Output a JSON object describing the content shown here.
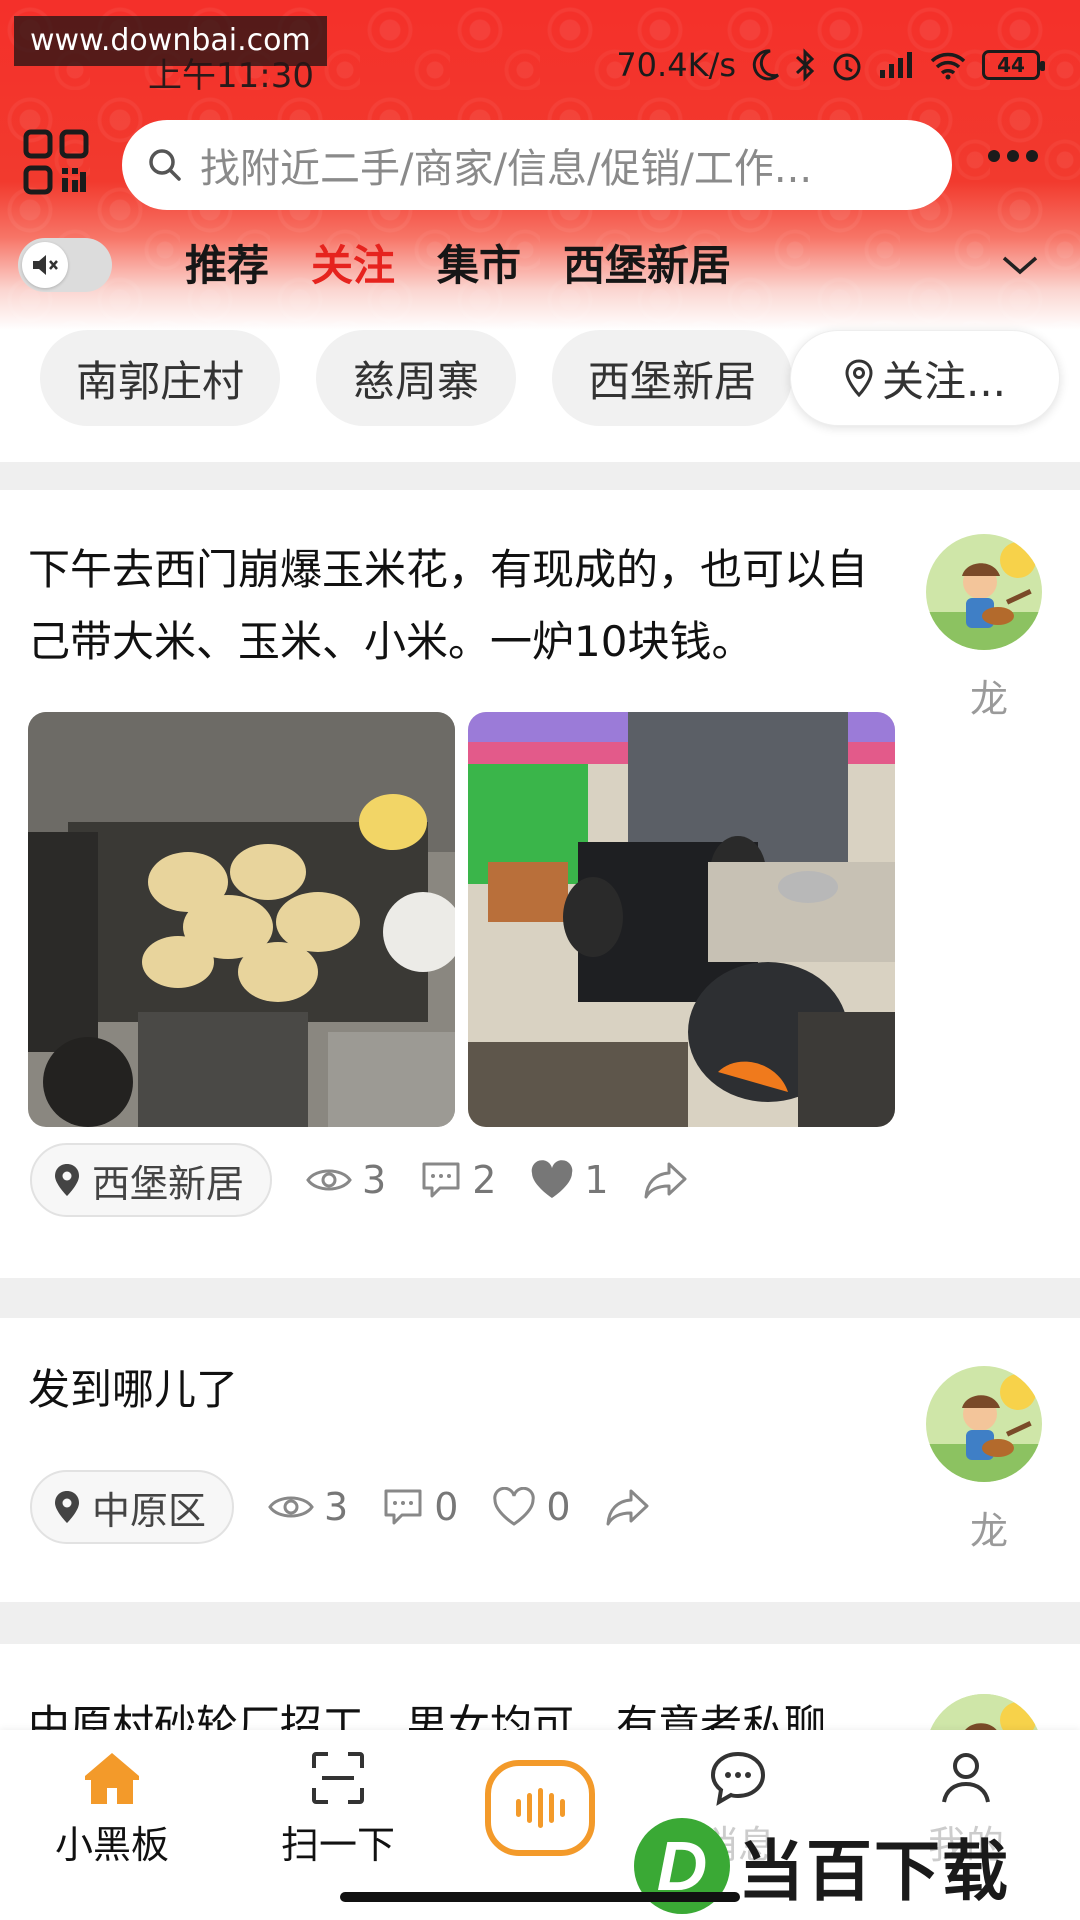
{
  "watermark_top": "www.downbai.com",
  "status": {
    "time": "上午11:30",
    "speed": "70.4K/s",
    "battery": "44"
  },
  "search": {
    "placeholder": "找附近二手/商家/信息/促销/工作..."
  },
  "tabs": [
    {
      "label": "推荐",
      "active": false
    },
    {
      "label": "关注",
      "active": true
    },
    {
      "label": "集市",
      "active": false
    },
    {
      "label": "西堡新居",
      "active": false
    }
  ],
  "location_chips": [
    "南郭庄村",
    "慈周寨",
    "西堡新居",
    "关注..."
  ],
  "posts": [
    {
      "text": "下午去西门崩爆玉米花，有现成的，也可以自己带大米、玉米、小米。一炉10块钱。",
      "author": "龙",
      "location": "西堡新居",
      "views": "3",
      "comments": "2",
      "likes": "1"
    },
    {
      "text": "发到哪儿了",
      "author": "龙",
      "location": "中原区",
      "views": "3",
      "comments": "0",
      "likes": "0"
    },
    {
      "text": "中原村砂轮厂招工，男女均可，有意者私聊"
    }
  ],
  "bottom_nav": {
    "home": "小黑板",
    "scan": "扫一下",
    "messages": "消息",
    "me": "我的"
  },
  "watermark_bottom": "当百下载",
  "colors": {
    "header_red": "#f4302a",
    "active_tab": "#e6231e",
    "accent_orange": "#f39a2a"
  }
}
